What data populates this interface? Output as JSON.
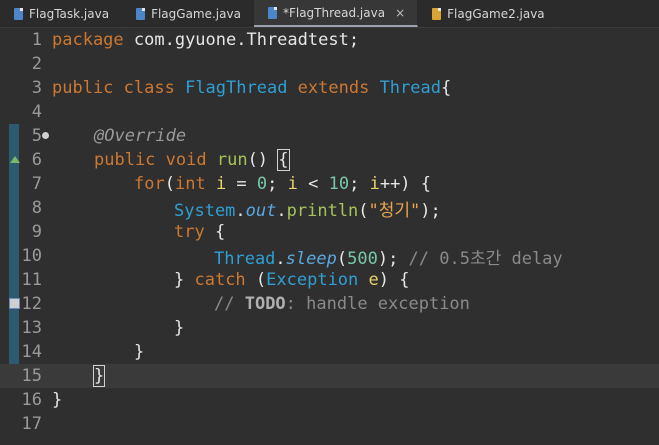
{
  "tabs": [
    {
      "label": "FlagTask.java",
      "active": false,
      "icon": "java-file-icon"
    },
    {
      "label": "FlagGame.java",
      "active": false,
      "icon": "java-file-icon"
    },
    {
      "label": "*FlagThread.java",
      "active": true,
      "icon": "java-file-icon",
      "close": "×"
    },
    {
      "label": "FlagGame2.java",
      "active": false,
      "icon": "java-file-warning-icon"
    }
  ],
  "editor": {
    "line_numbers": [
      "1",
      "2",
      "3",
      "4",
      "5",
      "6",
      "7",
      "8",
      "9",
      "10",
      "11",
      "12",
      "13",
      "14",
      "15",
      "16",
      "17"
    ],
    "current_line": 15,
    "lines": {
      "l1_pkg": "package",
      "l1_name": " com.gyuone.Threadtest;",
      "l3_public": "public",
      "l3_class": " class ",
      "l3_name": "FlagThread",
      "l3_extends": " extends ",
      "l3_super": "Thread",
      "l3_brace": "{",
      "l5_ann": "@Override",
      "l6_public": "public",
      "l6_void": " void ",
      "l6_run": "run",
      "l6_paren": "() ",
      "l6_brace": "{",
      "l7_for": "for",
      "l7_open": "(",
      "l7_int": "int",
      "l7_sp": " ",
      "l7_i1": "i",
      "l7_eq": " = ",
      "l7_zero": "0",
      "l7_semi": "; ",
      "l7_i2": "i",
      "l7_lt": " < ",
      "l7_ten": "10",
      "l7_semi2": "; ",
      "l7_i3": "i",
      "l7_inc": "++) {",
      "l8_system": "System",
      "l8_dot": ".",
      "l8_out": "out",
      "l8_dot2": ".",
      "l8_println": "println",
      "l8_open": "(",
      "l8_str": "\"청기\"",
      "l8_close": ");",
      "l9_try": "try",
      "l9_brace": " {",
      "l10_thread": "Thread",
      "l10_dot": ".",
      "l10_sleep": "sleep",
      "l10_open": "(",
      "l10_num": "500",
      "l10_close": "); ",
      "l10_comment": "// 0.5초간 delay",
      "l11_close": "} ",
      "l11_catch": "catch",
      "l11_open": " (",
      "l11_exc": "Exception",
      "l11_sp": " ",
      "l11_e": "e",
      "l11_brace": ") {",
      "l12_comment1": "// ",
      "l12_todo": "TODO",
      "l12_comment2": ": handle exception",
      "l13_brace": "}",
      "l14_brace": "}",
      "l15_brace": "}",
      "l16_brace": "}"
    }
  }
}
